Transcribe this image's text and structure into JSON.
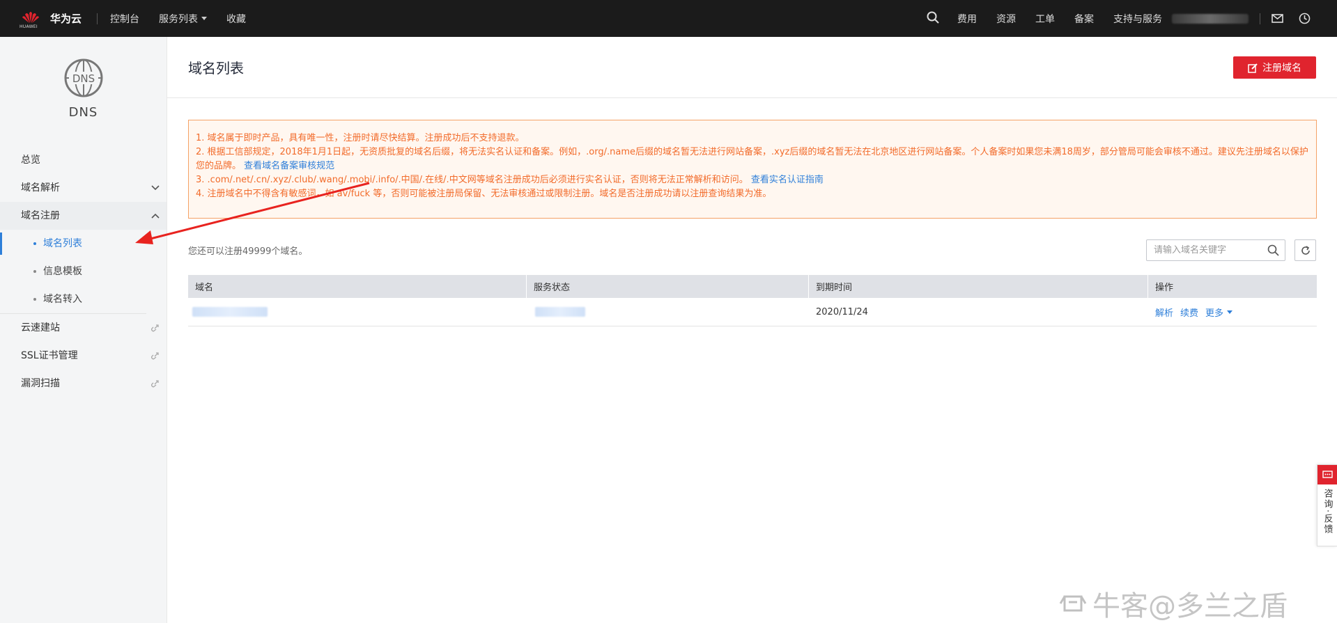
{
  "topbar": {
    "logo_small": "HUAWEI",
    "brand": "华为云",
    "nav": [
      "控制台",
      "服务列表",
      "收藏"
    ],
    "right_links": [
      "费用",
      "资源",
      "工单",
      "备案",
      "支持与服务"
    ],
    "icons": [
      "search-icon",
      "mail-icon",
      "clock-icon"
    ]
  },
  "sidebar": {
    "service_icon": "dns-globe-icon",
    "service_title": "DNS",
    "items": [
      {
        "label": "总览"
      },
      {
        "label": "域名解析"
      },
      {
        "label": "域名注册"
      },
      {
        "label": "云速建站"
      },
      {
        "label": "SSL证书管理"
      },
      {
        "label": "漏洞扫描"
      }
    ],
    "sub_items": [
      "域名列表",
      "信息模板",
      "域名转入"
    ],
    "active_sub": "域名列表"
  },
  "main": {
    "title": "域名列表",
    "register_button": "注册域名",
    "notice": {
      "line1": "1. 域名属于即时产品，具有唯一性，注册时请尽快结算。注册成功后不支持退款。",
      "line2": "2. 根据工信部规定，2018年1月1日起，无资质批复的域名后缀，将无法实名认证和备案。例如，.org/.name后缀的域名暂无法进行网站备案，.xyz后缀的域名暂无法在北京地区进行网站备案。个人备案时如果您未满18周岁，部分管局可能会审核不通过。建议先注册域名以保护您的品牌。",
      "line2_link": "查看域名备案审核规范",
      "line3": "3. .com/.net/.cn/.xyz/.club/.wang/.mobi/.info/.中国/.在线/.中文网等域名注册成功后必须进行实名认证，否则将无法正常解析和访问。",
      "line3_link": "查看实名认证指南",
      "line4": "4. 注册域名中不得含有敏感词，如 av/fuck 等，否则可能被注册局保留、无法审核通过或限制注册。域名是否注册成功请以注册查询结果为准。"
    },
    "quota_text": "您还可以注册49999个域名。",
    "search_placeholder": "请输入域名关键字",
    "table": {
      "headers": [
        "域名",
        "服务状态",
        "到期时间",
        "操作"
      ],
      "rows": [
        {
          "domain": "",
          "status": "",
          "expiry": "2020/11/24",
          "actions": [
            "解析",
            "续费",
            "更多"
          ]
        }
      ]
    }
  },
  "feedback": {
    "label": "咨询·反馈"
  },
  "watermark": "牛客@多兰之盾",
  "colors": {
    "brand_red": "#e0242e",
    "link_blue": "#2e7fd9",
    "notice_orange": "#f26b2a",
    "topbar_bg": "#1b1b1b"
  }
}
